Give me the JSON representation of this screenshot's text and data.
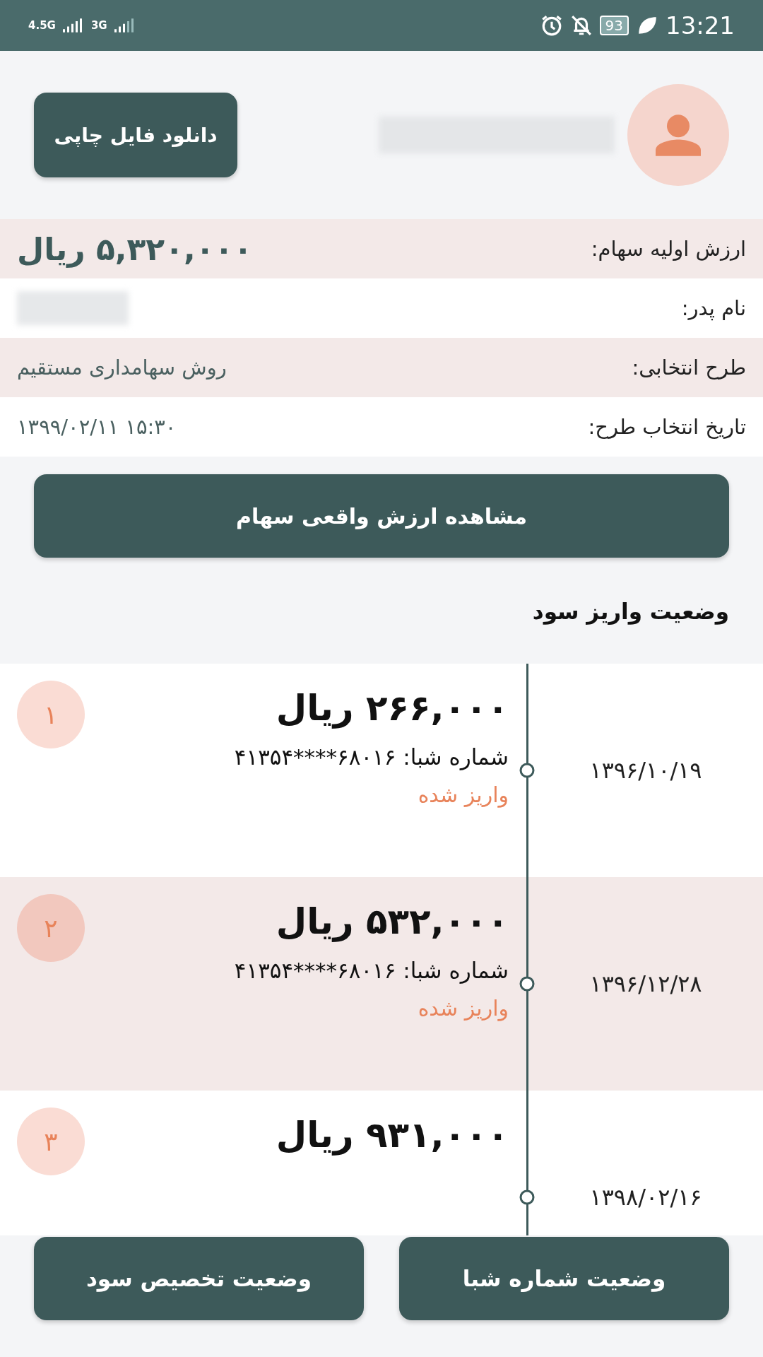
{
  "status_bar": {
    "network_1": "4.5G",
    "network_2": "3G",
    "battery": "93",
    "time": "13:21"
  },
  "header": {
    "download_button": "دانلود فایل چاپی"
  },
  "info_rows": [
    {
      "label": "ارزش اولیه سهام:",
      "value": "۵,۳۲۰,۰۰۰ ریال",
      "kind": "big"
    },
    {
      "label": "نام پدر:",
      "kind": "hidden"
    },
    {
      "label": "طرح انتخابی:",
      "value": "روش سهامداری مستقیم",
      "kind": "text"
    },
    {
      "label": "تاریخ انتخاب طرح:",
      "value": "۱۳۹۹/۰۲/۱۱ ۱۵:۳۰",
      "kind": "text"
    }
  ],
  "view_button": "مشاهده ارزش واقعی سهام",
  "section_title": "وضعیت واریز سود",
  "payments": [
    {
      "index": "۱",
      "amount": "۲۶۶,۰۰۰ ریال",
      "sheba_label": "شماره شبا:",
      "sheba": "۴۱۳۵۴****۶۸۰۱۶",
      "status": "واریز شده",
      "date": "۱۳۹۶/۱۰/۱۹"
    },
    {
      "index": "۲",
      "amount": "۵۳۲,۰۰۰ ریال",
      "sheba_label": "شماره شبا:",
      "sheba": "۴۱۳۵۴****۶۸۰۱۶",
      "status": "واریز شده",
      "date": "۱۳۹۶/۱۲/۲۸"
    },
    {
      "index": "۳",
      "amount": "۹۳۱,۰۰۰ ریال",
      "date": "۱۳۹۸/۰۲/۱۶"
    }
  ],
  "bottom_buttons": [
    "وضعیت شماره شبا",
    "وضعیت تخصیص سود"
  ]
}
